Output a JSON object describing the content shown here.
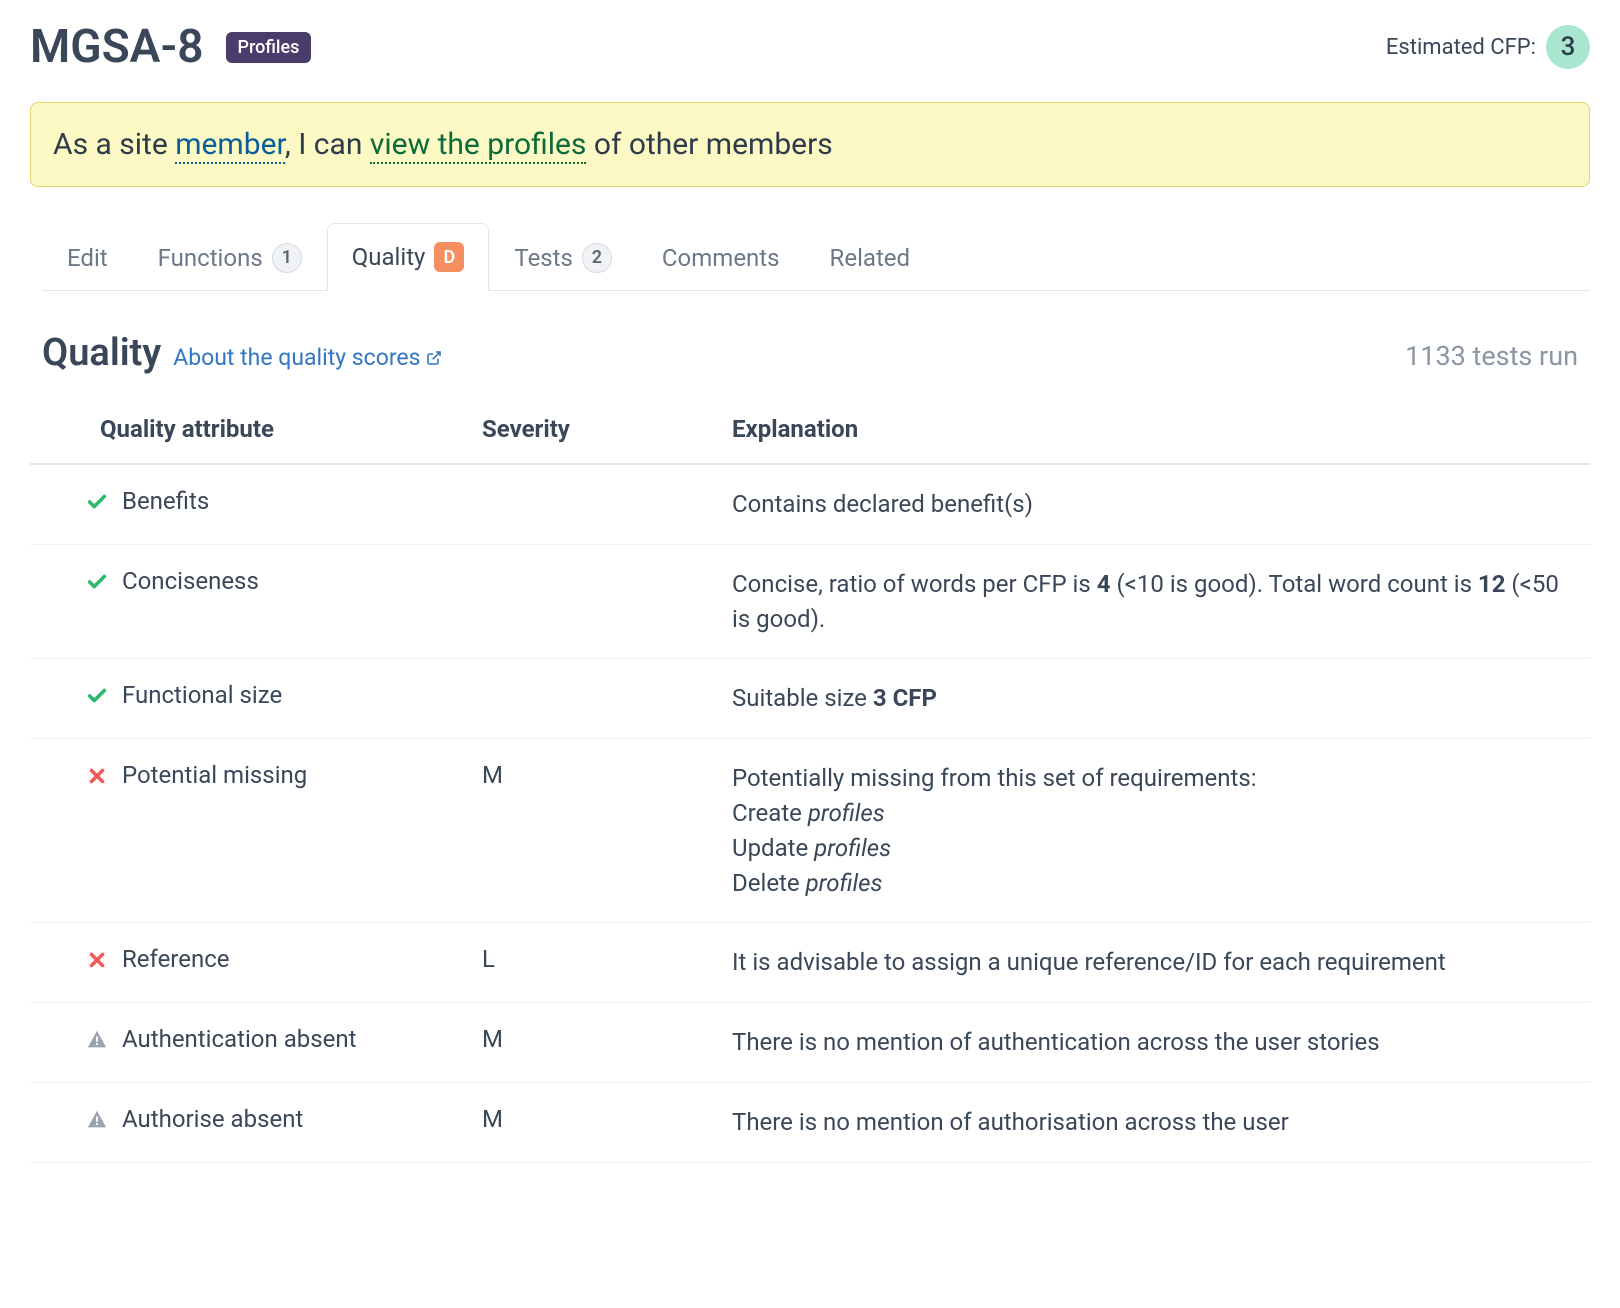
{
  "header": {
    "title": "MGSA-8",
    "badge": "Profiles",
    "estimated_cfp_label": "Estimated CFP:",
    "estimated_cfp_value": "3"
  },
  "story": {
    "prefix": "As a site ",
    "role": "member",
    "mid": ", I can ",
    "action": "view the profiles",
    "suffix": " of other members"
  },
  "tabs": {
    "edit": "Edit",
    "functions": "Functions",
    "functions_count": "1",
    "quality": "Quality",
    "quality_grade": "D",
    "tests": "Tests",
    "tests_count": "2",
    "comments": "Comments",
    "related": "Related"
  },
  "quality_section": {
    "title": "Quality",
    "about_link": "About the quality scores",
    "tests_run": "1133 tests run",
    "col_attribute": "Quality attribute",
    "col_severity": "Severity",
    "col_explanation": "Explanation"
  },
  "rows": [
    {
      "status": "pass",
      "attribute": "Benefits",
      "severity": "",
      "explanation_html": "Contains declared benefit(s)"
    },
    {
      "status": "pass",
      "attribute": "Conciseness",
      "severity": "",
      "explanation_html": "Concise, ratio of words per CFP is <strong>4</strong> (<10 is good). Total word count is <strong>12</strong> (<50 is good)."
    },
    {
      "status": "pass",
      "attribute": "Functional size",
      "severity": "",
      "explanation_html": "Suitable size <strong>3 CFP</strong>"
    },
    {
      "status": "fail",
      "attribute": "Potential missing",
      "severity": "M",
      "explanation_html": "Potentially missing from this set of requirements:<br>Create <em>profiles</em><br>Update <em>profiles</em><br>Delete <em>profiles</em>"
    },
    {
      "status": "fail",
      "attribute": "Reference",
      "severity": "L",
      "explanation_html": "It is advisable to assign a unique reference/ID for each requirement"
    },
    {
      "status": "warn",
      "attribute": "Authentication absent",
      "severity": "M",
      "explanation_html": "There is no mention of authentication across the user stories"
    },
    {
      "status": "warn",
      "attribute": "Authorise absent",
      "severity": "M",
      "explanation_html": "There is no mention of authorisation across the user"
    }
  ]
}
